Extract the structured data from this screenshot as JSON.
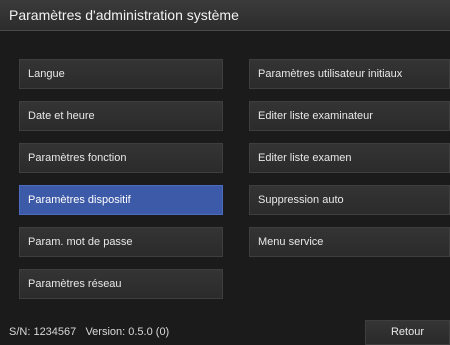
{
  "window": {
    "title": "Paramètres d'administration système"
  },
  "left_buttons": [
    {
      "label": "Langue"
    },
    {
      "label": "Date et heure"
    },
    {
      "label": "Paramètres fonction"
    },
    {
      "label": "Paramètres dispositif",
      "selected": true
    },
    {
      "label": "Param. mot de passe"
    },
    {
      "label": "Paramètres réseau"
    }
  ],
  "right_buttons": [
    {
      "label": "Paramètres utilisateur initiaux"
    },
    {
      "label": "Editer liste examinateur"
    },
    {
      "label": "Editer liste examen"
    },
    {
      "label": "Suppression auto"
    },
    {
      "label": "Menu service"
    }
  ],
  "footer": {
    "serial": "S/N: 1234567",
    "version": "Version: 0.5.0 (0)",
    "back_label": "Retour"
  },
  "colors": {
    "selected": "#3d5aa8",
    "background": "#1b1b1b"
  }
}
